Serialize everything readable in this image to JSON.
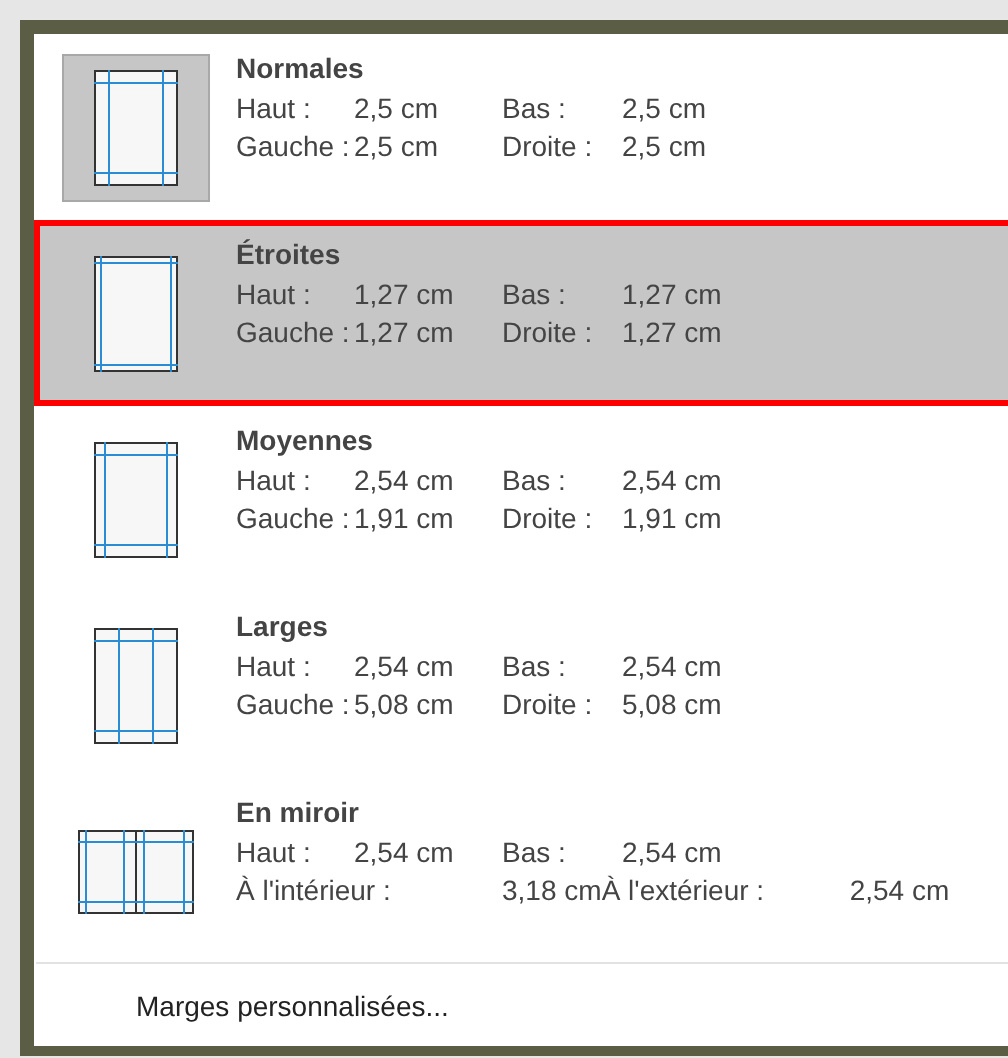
{
  "margin_presets": [
    {
      "kind": "normal",
      "title": "Normales",
      "current": true,
      "selected": false,
      "rows": [
        {
          "label_1": "Haut :",
          "value_1": "2,5 cm",
          "label_2": "Bas :",
          "value_2": "2,5 cm"
        },
        {
          "label_1": "Gauche :",
          "value_1": "2,5 cm",
          "label_2": "Droite :",
          "value_2": "2,5 cm"
        }
      ]
    },
    {
      "kind": "narrow",
      "title": "Étroites",
      "current": false,
      "selected": true,
      "rows": [
        {
          "label_1": "Haut :",
          "value_1": "1,27 cm",
          "label_2": "Bas :",
          "value_2": "1,27 cm"
        },
        {
          "label_1": "Gauche :",
          "value_1": "1,27 cm",
          "label_2": "Droite :",
          "value_2": "1,27 cm"
        }
      ]
    },
    {
      "kind": "moderate",
      "title": "Moyennes",
      "current": false,
      "selected": false,
      "rows": [
        {
          "label_1": "Haut :",
          "value_1": "2,54 cm",
          "label_2": "Bas :",
          "value_2": "2,54 cm"
        },
        {
          "label_1": "Gauche :",
          "value_1": "1,91 cm",
          "label_2": "Droite :",
          "value_2": "1,91 cm"
        }
      ]
    },
    {
      "kind": "wide",
      "title": "Larges",
      "current": false,
      "selected": false,
      "rows": [
        {
          "label_1": "Haut :",
          "value_1": "2,54 cm",
          "label_2": "Bas :",
          "value_2": "2,54 cm"
        },
        {
          "label_1": "Gauche :",
          "value_1": "5,08 cm",
          "label_2": "Droite :",
          "value_2": "5,08 cm"
        }
      ]
    },
    {
      "kind": "mirrored",
      "title": "En miroir",
      "current": false,
      "selected": false,
      "rows": [
        {
          "label_1": "Haut :",
          "value_1": "2,54 cm",
          "label_2": "Bas :",
          "value_2": "2,54 cm"
        },
        {
          "label_1": "À l'intérieur :",
          "value_1": "3,18 cm",
          "label_2": "À l'extérieur :",
          "value_2": "2,54 cm"
        }
      ]
    }
  ],
  "custom_margins": {
    "label": "Marges personnalisées..."
  }
}
